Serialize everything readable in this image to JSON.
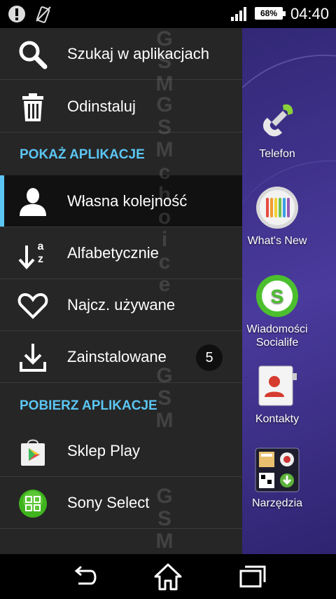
{
  "status_bar": {
    "time": "04:40",
    "battery": "68%",
    "icons": [
      "alert-icon",
      "no-vibration-icon",
      "signal-icon",
      "battery-icon"
    ]
  },
  "drawer": {
    "actions": [
      {
        "label": "Szukaj w aplikacjach",
        "icon": "search-icon"
      },
      {
        "label": "Odinstaluj",
        "icon": "trash-icon"
      }
    ],
    "show_section": "POKAŻ APLIKACJE",
    "show_items": [
      {
        "label": "Własna kolejność",
        "icon": "person-icon",
        "selected": true
      },
      {
        "label": "Alfabetycznie",
        "icon": "sort-az-icon"
      },
      {
        "label": "Najcz. używane",
        "icon": "heart-icon"
      },
      {
        "label": "Zainstalowane",
        "icon": "download-icon",
        "badge": "5"
      }
    ],
    "get_section": "POBIERZ APLIKACJE",
    "get_items": [
      {
        "label": "Sklep Play",
        "icon": "play-store-icon"
      },
      {
        "label": "Sony Select",
        "icon": "sony-select-icon"
      }
    ]
  },
  "dock_apps": [
    {
      "label": "Telefon",
      "icon": "phone-icon"
    },
    {
      "label": "What's New",
      "icon": "whats-new-icon"
    },
    {
      "label": "Wiadomości\nSocialife",
      "icon": "socialife-icon"
    },
    {
      "label": "Kontakty",
      "icon": "contacts-icon"
    },
    {
      "label": "Narzędzia",
      "icon": "tools-folder-icon"
    }
  ],
  "watermark": {
    "text_top": "GSMchoice",
    "text_bottom": "GSM"
  },
  "colors": {
    "accent": "#5bc6f3",
    "drawer_bg": "#262626",
    "wallpaper": "#3b2f86"
  }
}
